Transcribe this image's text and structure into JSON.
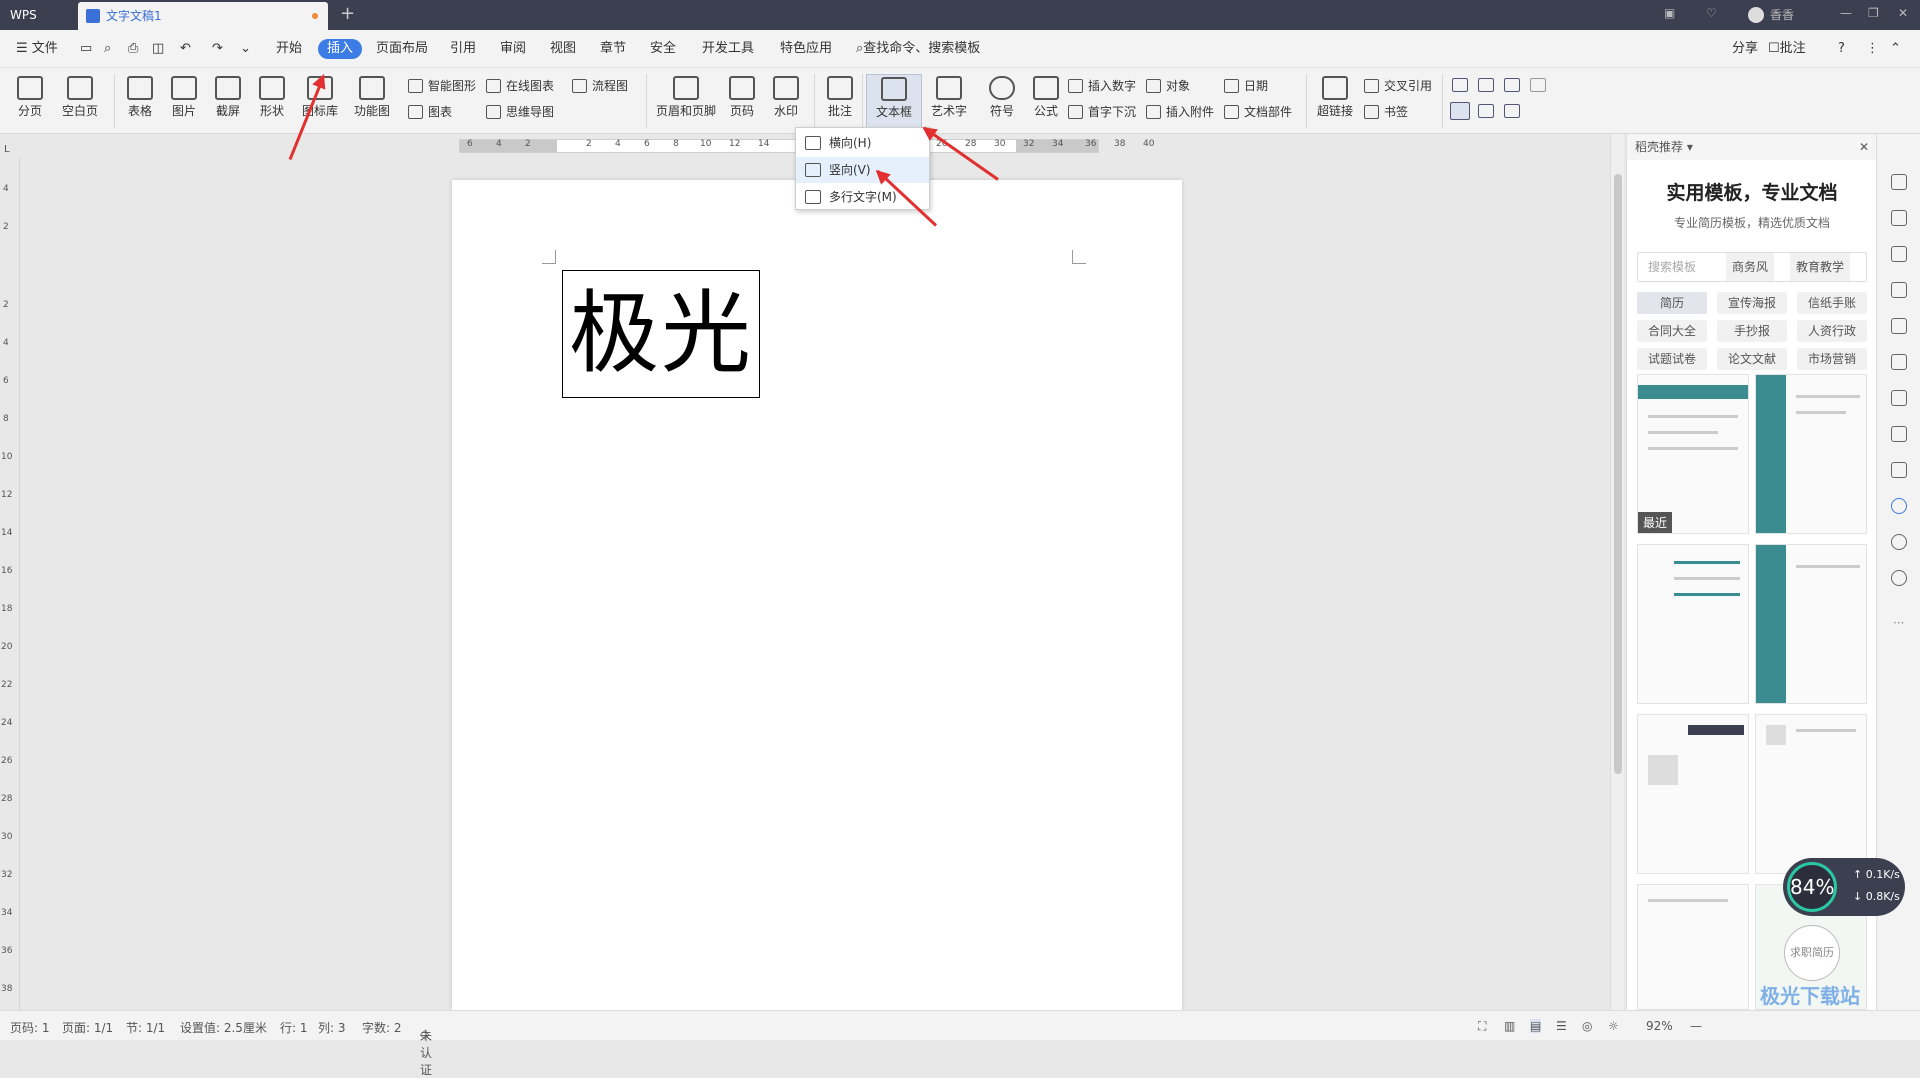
{
  "titlebar": {
    "app": "WPS",
    "tab": "文字文稿1",
    "new_tab": "+",
    "user": "香香"
  },
  "menubar": {
    "file": "文件",
    "items": [
      "开始",
      "插入",
      "页面布局",
      "引用",
      "审阅",
      "视图",
      "章节",
      "安全",
      "开发工具",
      "特色应用"
    ],
    "active_index": 1,
    "search": "查找命令、搜索模板",
    "share": "分享",
    "comment": "批注",
    "help": "?"
  },
  "ribbon": {
    "big": [
      "分页",
      "空白页",
      "表格",
      "图片",
      "截屏",
      "形状",
      "图标库",
      "功能图",
      "页眉和页脚",
      "页码",
      "水印",
      "批注",
      "文本框",
      "艺术字",
      "符号",
      "公式",
      "超链接"
    ],
    "small": {
      "smart_shape": "智能图形",
      "online_chart": "在线图表",
      "flowchart": "流程图",
      "chart": "图表",
      "mindmap": "思维导图",
      "insert_number": "插入数字",
      "object": "对象",
      "date": "日期",
      "drop_cap": "首字下沉",
      "insert_attachment": "插入附件",
      "doc_parts": "文档部件",
      "cross_ref": "交叉引用",
      "bookmark": "书签"
    }
  },
  "ruler": {
    "ticks": [
      "6",
      "4",
      "2",
      "2",
      "4",
      "6",
      "8",
      "10",
      "12",
      "14",
      "26",
      "28",
      "30",
      "32",
      "34",
      "36",
      "38",
      "40"
    ]
  },
  "vruler": {
    "ticks": [
      "4",
      "2",
      "2",
      "4",
      "6",
      "8",
      "10",
      "12",
      "14",
      "16",
      "18",
      "20",
      "22",
      "24",
      "26",
      "28",
      "30",
      "32",
      "34",
      "36",
      "38"
    ]
  },
  "document": {
    "textbox_text": "极光"
  },
  "dropdown": {
    "items": [
      "横向(H)",
      "竖向(V)",
      "多行文字(M)"
    ],
    "highlighted_index": 1
  },
  "panel": {
    "header": "稻壳推荐",
    "title": "实用模板，专业文档",
    "subtitle": "专业简历模板，精选优质文档",
    "search_placeholder": "搜索模板",
    "search_tags": [
      "商务风",
      "教育教学"
    ],
    "chips": [
      "简历",
      "宣传海报",
      "信纸手账",
      "合同大全",
      "手抄报",
      "人资行政",
      "试题试卷",
      "论文文献",
      "市场营销"
    ],
    "recent": "最近",
    "card_badge": "求职简历"
  },
  "statusbar": {
    "page_no": "页码: 1",
    "pages": "页面: 1/1",
    "section": "节: 1/1",
    "setting": "设置值: 2.5厘米",
    "row": "行: 1",
    "col": "列: 3",
    "words": "字数: 2",
    "cert": "未认证",
    "zoom": "92%"
  },
  "speed": {
    "percent": "84%",
    "up": "0.1K/s",
    "down": "0.8K/s"
  },
  "watermark": "极光下载站"
}
